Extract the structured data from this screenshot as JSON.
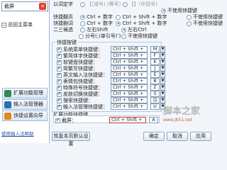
{
  "sidebar": {
    "search_value": "截屏",
    "tree_item": "总回主菜单",
    "nav": [
      {
        "label": "扩展功能管理",
        "icon": "extension-icon",
        "color": "#2e8b57"
      },
      {
        "label": "输入法管理器",
        "icon": "ime-manager-icon",
        "color": "#2b6cb0"
      },
      {
        "label": "快捷设置向导",
        "icon": "wizard-icon",
        "color": "#dd8a1e"
      }
    ],
    "link": "使用输入法帮助"
  },
  "settings": {
    "row1": {
      "label": "以词定字",
      "opt1": "【",
      "opt1_hint": "(减号)",
      "opt2_hint": "(等号)",
      "opt3": "【",
      "opt3_hint": "】(中括号)",
      "opt4": "不使用快捷键"
    },
    "row2": {
      "label": "快捷翻页",
      "opt1": "Ctrl + 数字",
      "opt2": "Ctrl + Shift + 数字",
      "opt3": "不使用快捷键"
    },
    "row3": {
      "label": "快捷删词",
      "opt1": "Ctrl + 数字",
      "opt2": "Ctrl + Shift + 数字",
      "opt3": "不使用快捷键"
    },
    "row4": {
      "label": "二三候选",
      "opt1": "左右Shift",
      "opt2": "左右Ctrl"
    },
    "row5": {
      "opt1": "分号(;)单引号(')",
      "opt2": "不使用快捷键"
    }
  },
  "hotkeys": {
    "title": "快捷按键",
    "items": [
      {
        "name": "系统菜单快捷键：",
        "combo": "Ctrl + Shift +",
        "key": "M"
      },
      {
        "name": "繁简体字快捷键：",
        "combo": "Ctrl + Shift +",
        "key": "F"
      },
      {
        "name": "软键盘快捷键：",
        "combo": "Ctrl + Shift +",
        "key": "K"
      },
      {
        "name": "简繁写快捷键：",
        "combo": "Ctrl + Shift +",
        "key": "J"
      },
      {
        "name": "英文输入法快捷键：",
        "combo": "Ctrl + Shift +",
        "key": "E"
      },
      {
        "name": "表情包快捷键：",
        "combo": "Ctrl + Shift +",
        "key": "B"
      },
      {
        "name": "特殊符号快捷键：",
        "combo": "Ctrl + Shift +",
        "key": "Z"
      },
      {
        "name": "皮肤切换快捷键：",
        "combo": "Ctrl + Shift +",
        "key": "S"
      },
      {
        "name": "搜索快捷键：",
        "combo": "Ctrl + Shift +",
        "key": "Q"
      },
      {
        "name": "输入法管理快捷键：",
        "combo": "Ctrl + Shift +",
        "key": "U"
      }
    ]
  },
  "extension": {
    "title": "扩展功能快捷键",
    "item_name": "截屏：",
    "combo": "Ctrl + Shift +",
    "key": "A"
  },
  "footer": {
    "restore": "恢复本页默认设置",
    "ok": "确定",
    "cancel": "取消",
    "apply": "应用"
  },
  "watermark": {
    "text": "脚本之家",
    "url": "www.jb51.net"
  }
}
